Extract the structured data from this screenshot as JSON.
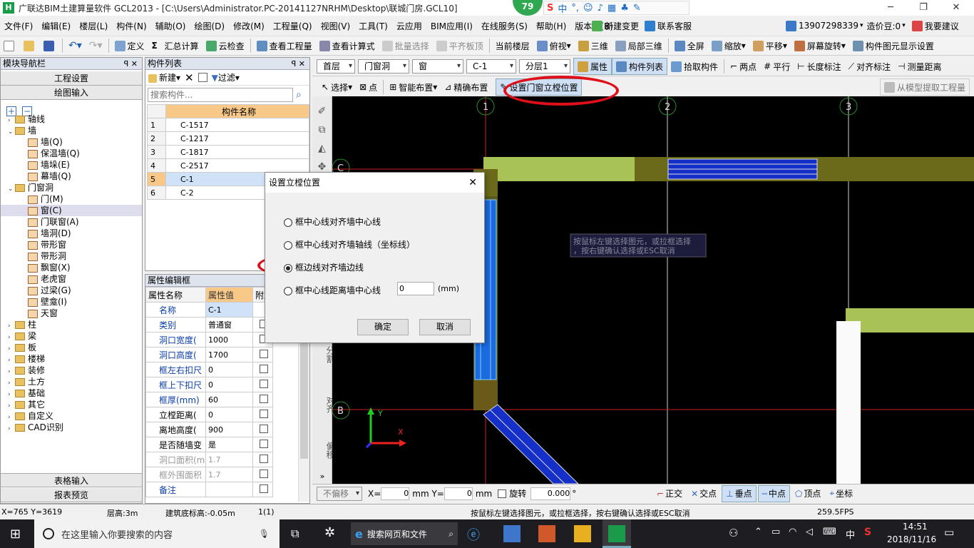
{
  "app": {
    "title": "广联达BIM土建算量软件 GCL2013 - [C:\\Users\\Administrator.PC-20141127NRHM\\Desktop\\联城门房.GCL10]",
    "logo_letter": "H",
    "badge": "79"
  },
  "menu": [
    "文件(F)",
    "编辑(E)",
    "楼层(L)",
    "构件(N)",
    "辅助(O)",
    "绘图(D)",
    "修改(M)",
    "工程量(Q)",
    "视图(V)",
    "工具(T)",
    "云应用",
    "BIM应用(I)",
    "在线服务(S)",
    "帮助(H)",
    "版本号(B)"
  ],
  "menu_right": {
    "new_change": "新建变更",
    "contact": "联系客服",
    "phone": "13907298339",
    "coins": "造价豆:0",
    "suggest": "我要建议"
  },
  "toolbar": {
    "define": "定义",
    "sum": "汇总计算",
    "cloud_check": "云检查",
    "view_qty": "查看工程量",
    "view_formula": "查看计算式",
    "batch_select": "批量选择",
    "flat_slab": "平齐板顶",
    "current_floor": "当前楼层",
    "top_view": "俯视",
    "three_d": "三维",
    "local_3d": "局部三维",
    "full_screen": "全屏",
    "zoom": "缩放",
    "pan": "平移",
    "rotate": "屏幕旋转",
    "display_setting": "构件图元显示设置"
  },
  "leftnav": {
    "title": "模块导航栏",
    "project_settings": "工程设置",
    "draw_input": "绘图输入",
    "table_input": "表格输入",
    "report_preview": "报表预览",
    "tree": [
      {
        "label": "轴线",
        "level": 0,
        "exp": "›"
      },
      {
        "label": "墙",
        "level": 0,
        "exp": "⌄"
      },
      {
        "label": "墙(Q)",
        "level": 1
      },
      {
        "label": "保温墙(Q)",
        "level": 1
      },
      {
        "label": "墙垛(E)",
        "level": 1
      },
      {
        "label": "幕墙(Q)",
        "level": 1
      },
      {
        "label": "门窗洞",
        "level": 0,
        "exp": "⌄"
      },
      {
        "label": "门(M)",
        "level": 1
      },
      {
        "label": "窗(C)",
        "level": 1,
        "selected": true
      },
      {
        "label": "门联窗(A)",
        "level": 1
      },
      {
        "label": "墙洞(D)",
        "level": 1
      },
      {
        "label": "带形窗",
        "level": 1
      },
      {
        "label": "带形洞",
        "level": 1
      },
      {
        "label": "飘窗(X)",
        "level": 1
      },
      {
        "label": "老虎窗",
        "level": 1
      },
      {
        "label": "过梁(G)",
        "level": 1
      },
      {
        "label": "壁龛(I)",
        "level": 1
      },
      {
        "label": "天窗",
        "level": 1
      },
      {
        "label": "柱",
        "level": 0,
        "exp": "›"
      },
      {
        "label": "梁",
        "level": 0,
        "exp": "›"
      },
      {
        "label": "板",
        "level": 0,
        "exp": "›"
      },
      {
        "label": "楼梯",
        "level": 0,
        "exp": "›"
      },
      {
        "label": "装修",
        "level": 0,
        "exp": "›"
      },
      {
        "label": "土方",
        "level": 0,
        "exp": "›"
      },
      {
        "label": "基础",
        "level": 0,
        "exp": "›"
      },
      {
        "label": "其它",
        "level": 0,
        "exp": "›"
      },
      {
        "label": "自定义",
        "level": 0,
        "exp": "›"
      },
      {
        "label": "CAD识别",
        "level": 0,
        "exp": "›"
      }
    ]
  },
  "complist": {
    "title": "构件列表",
    "new": "新建",
    "filter": "过滤",
    "search_placeholder": "搜索构件...",
    "col": "构件名称",
    "rows": [
      {
        "n": "1",
        "name": "C-1517"
      },
      {
        "n": "2",
        "name": "C-1217"
      },
      {
        "n": "3",
        "name": "C-1817"
      },
      {
        "n": "4",
        "name": "C-2517"
      },
      {
        "n": "5",
        "name": "C-1",
        "sel": true
      },
      {
        "n": "6",
        "name": "C-2"
      }
    ]
  },
  "props": {
    "title": "属性编辑框",
    "col_name": "属性名称",
    "col_val": "属性值",
    "col_add": "附加",
    "rows": [
      {
        "name": "名称",
        "val": "C-1",
        "blue": true,
        "cb": false
      },
      {
        "name": "类别",
        "val": "普通窗",
        "blue": true,
        "cb": true
      },
      {
        "name": "洞口宽度(",
        "val": "1000",
        "blue": true,
        "cb": true
      },
      {
        "name": "洞口高度(",
        "val": "1700",
        "blue": true,
        "cb": true
      },
      {
        "name": "框左右扣尺",
        "val": "0",
        "blue": true,
        "cb": true
      },
      {
        "name": "框上下扣尺",
        "val": "0",
        "blue": true,
        "cb": true
      },
      {
        "name": "框厚(mm)",
        "val": "60",
        "blue": true,
        "cb": true
      },
      {
        "name": "立樘距离(",
        "val": "0",
        "blue": false,
        "cb": true
      },
      {
        "name": "离地高度(",
        "val": "900",
        "blue": false,
        "cb": true
      },
      {
        "name": "是否随墙变",
        "val": "是",
        "blue": false,
        "cb": true
      },
      {
        "name": "洞口面积(m",
        "val": "1.7",
        "gray": true,
        "cb": true
      },
      {
        "name": "框外围面积",
        "val": "1.7",
        "gray": true,
        "cb": true
      },
      {
        "name": "备注",
        "val": "",
        "blue": true,
        "cb": true
      }
    ]
  },
  "drawbar": {
    "floor": "首层",
    "type": "门窗洞",
    "subtype": "窗",
    "comp": "C-1",
    "layer": "分层1",
    "attr": "属性",
    "complist": "构件列表",
    "pick": "拾取构件",
    "two_points": "两点",
    "parallel": "平行",
    "length_mark": "长度标注",
    "align_mark": "对齐标注",
    "measure": "测量距离"
  },
  "drawbar2": {
    "select": "选择",
    "point": "点",
    "smart": "智能布置",
    "precise": "精确布置",
    "set_pos": "设置门窗立樘位置",
    "extract": "从模型提取工程量"
  },
  "vtools": [
    "分割",
    "对齐",
    "偏移"
  ],
  "canvas": {
    "axes": [
      "1",
      "2",
      "3"
    ],
    "rows": [
      "C",
      "B"
    ],
    "hint": "按鼠标左键选择图元，或拉框选择，按右键确认选择或ESC取消",
    "xlabel": "X",
    "ylabel": "Y"
  },
  "dialog": {
    "title": "设置立樘位置",
    "options": [
      "框中心线对齐墙中心线",
      "框中心线对齐墙轴线（坐标线）",
      "框边线对齐墙边线",
      "框中心线距离墙中心线"
    ],
    "selected": 2,
    "distance": "0",
    "unit": "(mm)",
    "ok": "确定",
    "cancel": "取消"
  },
  "bottombar": {
    "no_offset": "不偏移",
    "x_label": "X=",
    "x_val": "0",
    "y_label": "mm Y=",
    "y_val": "0",
    "mm": "mm",
    "rotate": "旋转",
    "angle": "0.000",
    "deg": "°",
    "ortho": "正交",
    "intersect": "交点",
    "perp": "垂点",
    "mid": "中点",
    "vertex": "顶点",
    "coord": "坐标"
  },
  "status": {
    "xy": "X=765 Y=3619",
    "height": "层高:3m",
    "bottom": "建筑底标高:-0.05m",
    "count": "1(1)",
    "hint": "按鼠标左键选择图元，或拉框选择，按右键确认选择或ESC取消",
    "fps": "259.5FPS"
  },
  "taskbar": {
    "search": "在这里输入你要搜索的内容",
    "browser_search": "搜索网页和文件",
    "ime": "中",
    "time": "14:51",
    "date": "2018/11/16"
  }
}
